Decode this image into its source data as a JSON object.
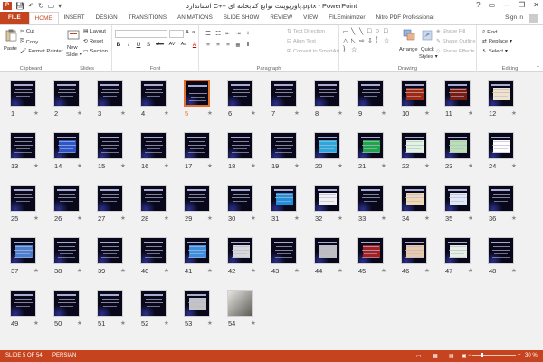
{
  "window": {
    "title": "استاندارد C++ پاورپوینت توابع کتابخانه ای.pptx - PowerPoint",
    "app_icon_letter": "P",
    "controls": [
      "?",
      "▭",
      "—",
      "❐",
      "✕"
    ]
  },
  "tabs": [
    {
      "label": "FILE"
    },
    {
      "label": "HOME"
    },
    {
      "label": "INSERT"
    },
    {
      "label": "DESIGN"
    },
    {
      "label": "TRANSITIONS"
    },
    {
      "label": "ANIMATIONS"
    },
    {
      "label": "SLIDE SHOW"
    },
    {
      "label": "REVIEW"
    },
    {
      "label": "VIEW"
    },
    {
      "label": "FILEminimizer"
    },
    {
      "label": "Nitro PDF Professional"
    }
  ],
  "signin_label": "Sign in",
  "ribbon": {
    "clipboard": {
      "label": "Clipboard",
      "paste": "Paste",
      "cut": "Cut",
      "copy": "Copy",
      "format_painter": "Format Painter"
    },
    "slides": {
      "label": "Slides",
      "new_slide_1": "New",
      "new_slide_2": "Slide",
      "layout": "Layout",
      "reset": "Reset",
      "section": "Section"
    },
    "font": {
      "label": "Font",
      "bold": "B",
      "italic": "I",
      "underline": "U",
      "strike": "S",
      "abc": "abc",
      "shadow": "AV",
      "aa": "Aa",
      "font_color": "A"
    },
    "paragraph": {
      "label": "Paragraph",
      "text_direction": "Text Direction",
      "align_text": "Align Text",
      "convert_smartart": "Convert to SmartArt"
    },
    "drawing": {
      "label": "Drawing",
      "arrange": "Arrange",
      "quick_1": "Quick",
      "quick_2": "Styles",
      "shape_fill": "Shape Fill",
      "shape_outline": "Shape Outline",
      "shape_effects": "Shape Effects"
    },
    "editing": {
      "label": "Editing",
      "find": "Find",
      "replace": "Replace",
      "select": "Select"
    }
  },
  "slides": [
    {
      "n": "1"
    },
    {
      "n": "2"
    },
    {
      "n": "3"
    },
    {
      "n": "4"
    },
    {
      "n": "5"
    },
    {
      "n": "6"
    },
    {
      "n": "7"
    },
    {
      "n": "8"
    },
    {
      "n": "9"
    },
    {
      "n": "10"
    },
    {
      "n": "11"
    },
    {
      "n": "12"
    },
    {
      "n": "13"
    },
    {
      "n": "14"
    },
    {
      "n": "15"
    },
    {
      "n": "16"
    },
    {
      "n": "17"
    },
    {
      "n": "18"
    },
    {
      "n": "19"
    },
    {
      "n": "20"
    },
    {
      "n": "21"
    },
    {
      "n": "22"
    },
    {
      "n": "23"
    },
    {
      "n": "24"
    },
    {
      "n": "25"
    },
    {
      "n": "26"
    },
    {
      "n": "27"
    },
    {
      "n": "28"
    },
    {
      "n": "29"
    },
    {
      "n": "30"
    },
    {
      "n": "31"
    },
    {
      "n": "32"
    },
    {
      "n": "33"
    },
    {
      "n": "34"
    },
    {
      "n": "35"
    },
    {
      "n": "36"
    },
    {
      "n": "37"
    },
    {
      "n": "38"
    },
    {
      "n": "39"
    },
    {
      "n": "40"
    },
    {
      "n": "41"
    },
    {
      "n": "42"
    },
    {
      "n": "43"
    },
    {
      "n": "44"
    },
    {
      "n": "45"
    },
    {
      "n": "46"
    },
    {
      "n": "47"
    },
    {
      "n": "48"
    },
    {
      "n": "49"
    },
    {
      "n": "50"
    },
    {
      "n": "51"
    },
    {
      "n": "52"
    },
    {
      "n": "53"
    },
    {
      "n": "54"
    }
  ],
  "selected_slide": "5",
  "slide_styles": {
    "10": {
      "box": "#a02a10",
      "fill": true
    },
    "11": {
      "box": "#7a1c10",
      "fill": true
    },
    "12": {
      "box": "#f1e3c8",
      "fill": true
    },
    "14": {
      "box": "#2c55c7",
      "fill": true
    },
    "20": {
      "box": "#2aa8d9",
      "fill": true
    },
    "21": {
      "box": "#1fa64a",
      "fill": true
    },
    "22": {
      "box": "#dff5dd",
      "fill": true
    },
    "23": {
      "box": "#b8e0b0",
      "fill": true
    },
    "24": {
      "box": "#ffffff",
      "fill": true
    },
    "31": {
      "box": "#1f8fd8",
      "fill": true
    },
    "32": {
      "box": "#f1f1f1",
      "fill": true
    },
    "34": {
      "box": "#f0d8b0",
      "fill": true
    },
    "35": {
      "box": "#dfe8f4",
      "fill": true
    },
    "37": {
      "box": "#4a7fd0",
      "fill": true
    },
    "41": {
      "box": "#3b8fdf",
      "fill": true
    },
    "42": {
      "box": "#d8d8d8",
      "fill": true
    },
    "44": {
      "box": "#bfbfbf",
      "fill": true
    },
    "45": {
      "box": "#a52020",
      "fill": true
    },
    "46": {
      "box": "#e9c9a8",
      "fill": true
    },
    "47": {
      "box": "#e6f0e0",
      "fill": true
    },
    "53": {
      "box": "#c4c4c4",
      "fill": true
    },
    "54": {
      "photo": true
    }
  },
  "status_bar": {
    "slide_info": "SLIDE 5 OF 54",
    "language": "PERSIAN",
    "zoom": "30 %",
    "zoom_minus": "−",
    "zoom_plus": "+"
  },
  "colors": {
    "accent": "#c5441f",
    "selection": "#e0702a"
  }
}
